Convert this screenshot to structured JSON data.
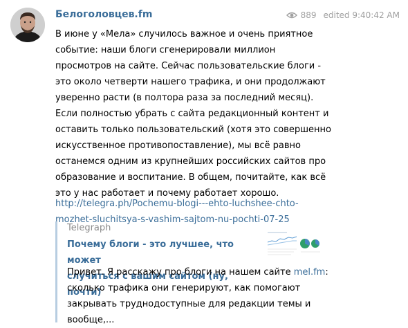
{
  "channel": {
    "name": "Белоголовцев.fm",
    "views": "889",
    "edited": "edited 9:40:42 AM"
  },
  "message": {
    "text": "В июне у «Мела» случилось важное и очень приятное\nсобытие: наши блоги сгенерировали миллион\nпросмотров на сайте. Сейчас пользовательские блоги -\nэто около четверти нашего трафика, и они продолжают\nуверенно расти (в полтора раза за последний месяц).\nЕсли полностью убрать с сайта редакционный контент и\nоставить только пользовательский (хотя это совершенно\nискусственное противопоставление), мы всё равно\nостанемся одним из крупнейших российских сайтов про\nобразование и воспитание. В общем, почитайте, как всё\nэто у нас работает и почему работает хорошо.",
    "link_line1": "http://telegra.ph/Pochemu-blogi---ehto-luchshee-chto-",
    "link_line2": "mozhet-sluchitsya-s-vashim-sajtom-nu-pochti-07-25"
  },
  "preview": {
    "site": "Telegraph",
    "title": "Почему блоги - это лучшее, что может\nслучиться с вашим сайтом (ну, почти)",
    "desc_before": "Привет. Я расскажу про блоги на нашем сайте ",
    "desc_link": "mel.fm",
    "desc_after": ":\nсколько трафика они генерируют, как помогают\nзакрывать труднодоступные для редакции темы и\nвообще,..."
  },
  "icons": {
    "views": "eye-icon"
  },
  "colors": {
    "link": "#3a6d99",
    "meta": "#a0a0a0",
    "preview_bar": "#b7cde1"
  }
}
